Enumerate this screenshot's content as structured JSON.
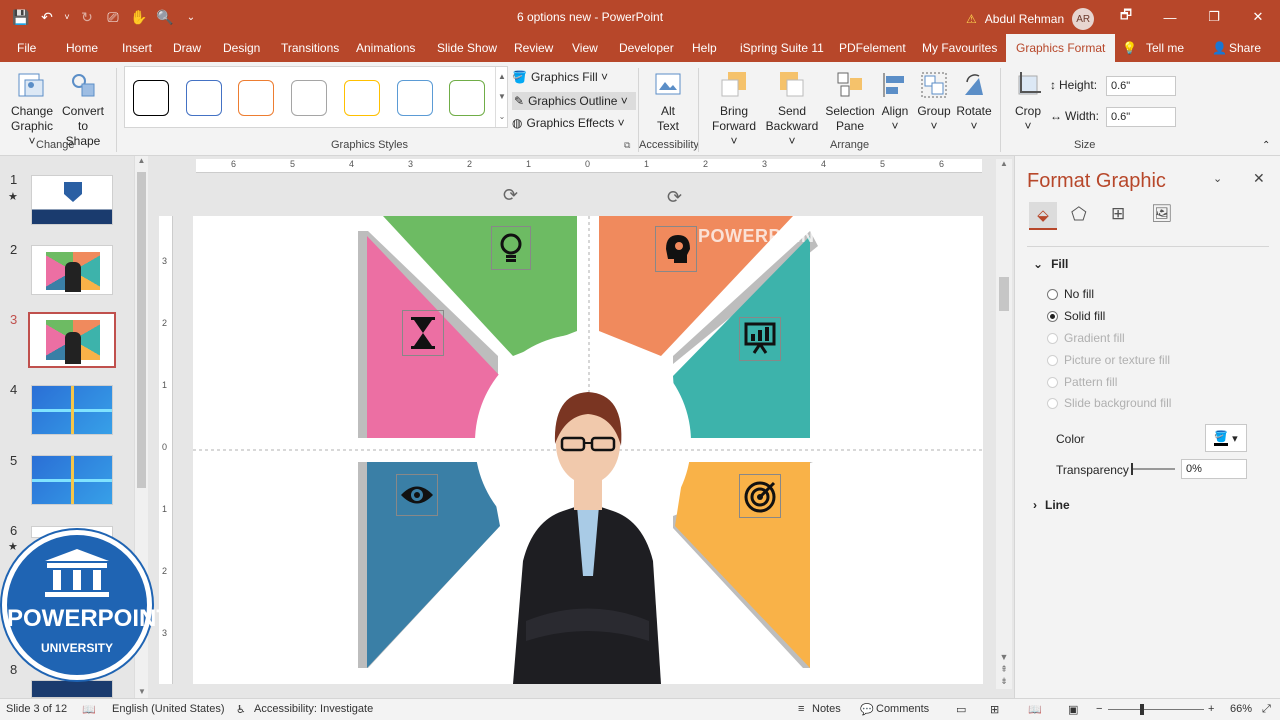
{
  "window": {
    "title": "6 options new  -  PowerPoint",
    "user_name": "Abdul Rehman",
    "user_initials": "AR",
    "min": "—",
    "restore": "❐",
    "close": "✕",
    "ribbon_display": "🗗"
  },
  "tabs": [
    "File",
    "Home",
    "Insert",
    "Draw",
    "Design",
    "Transitions",
    "Animations",
    "Slide Show",
    "Review",
    "View",
    "Developer",
    "Help",
    "iSpring Suite 11",
    "PDFelement",
    "My Favourites",
    "Graphics Format",
    "Tell me",
    "Share"
  ],
  "ribbon": {
    "change_graphic": [
      "Change",
      "Graphic ˅"
    ],
    "convert_to_shape": [
      "Convert",
      "to Shape"
    ],
    "group_change": "Change",
    "group_graphics_styles": "Graphics Styles",
    "graphics_fill": "Graphics Fill ˅",
    "graphics_outline": "Graphics Outline ˅",
    "graphics_effects": "Graphics Effects ˅",
    "alt_text": [
      "Alt",
      "Text"
    ],
    "group_accessibility": "Accessibility",
    "bring_forward": [
      "Bring",
      "Forward ˅"
    ],
    "send_backward": [
      "Send",
      "Backward ˅"
    ],
    "selection_pane": [
      "Selection",
      "Pane"
    ],
    "align": [
      "Align",
      "˅"
    ],
    "group": [
      "Group",
      "˅"
    ],
    "rotate": [
      "Rotate",
      "˅"
    ],
    "group_arrange": "Arrange",
    "crop": [
      "Crop",
      "˅"
    ],
    "height_label": "Height:",
    "height_value": "0.6\"",
    "width_label": "Width:",
    "width_value": "0.6\"",
    "group_size": "Size",
    "style_colors": [
      "#000000",
      "#4472c4",
      "#ed7d31",
      "#a5a5a5",
      "#ffc000",
      "#5b9bd5",
      "#70ad47"
    ]
  },
  "thumbs": [
    {
      "num": "1",
      "star": "★"
    },
    {
      "num": "2",
      "star": ""
    },
    {
      "num": "3",
      "star": ""
    },
    {
      "num": "4",
      "star": ""
    },
    {
      "num": "5",
      "star": ""
    },
    {
      "num": "6",
      "star": "★"
    },
    {
      "num": "8",
      "star": ""
    }
  ],
  "ruler_h": [
    "6",
    "5",
    "4",
    "3",
    "2",
    "1",
    "0",
    "1",
    "2",
    "3",
    "4",
    "5",
    "6"
  ],
  "ruler_v": [
    "3",
    "2",
    "1",
    "0",
    "1",
    "2",
    "3"
  ],
  "slide": {
    "watermark": "POWERPOINT UNIVERSITY",
    "logo_title": "POWERPOINT",
    "logo_subtitle": "UNIVERSITY",
    "colors": {
      "green": "#6dbb63",
      "orange": "#f08a5d",
      "pink": "#ec6fa3",
      "teal": "#3db3ab",
      "blue": "#3a7fa6",
      "yellow": "#f9b248"
    }
  },
  "pane": {
    "title": "Format Graphic",
    "section_fill": "Fill",
    "options": [
      {
        "label": "No fill",
        "state": "off"
      },
      {
        "label": "Solid fill",
        "state": "on"
      },
      {
        "label": "Gradient fill",
        "state": "dis"
      },
      {
        "label": "Picture or texture fill",
        "state": "dis"
      },
      {
        "label": "Pattern fill",
        "state": "dis"
      },
      {
        "label": "Slide background fill",
        "state": "dis"
      }
    ],
    "color_label": "Color",
    "transparency_label": "Transparency",
    "transparency_value": "0%",
    "section_line": "Line"
  },
  "status": {
    "slide_of": "Slide 3 of 12",
    "language": "English (United States)",
    "accessibility": "Accessibility: Investigate",
    "notes": "Notes",
    "comments": "Comments",
    "zoom": "66%"
  }
}
